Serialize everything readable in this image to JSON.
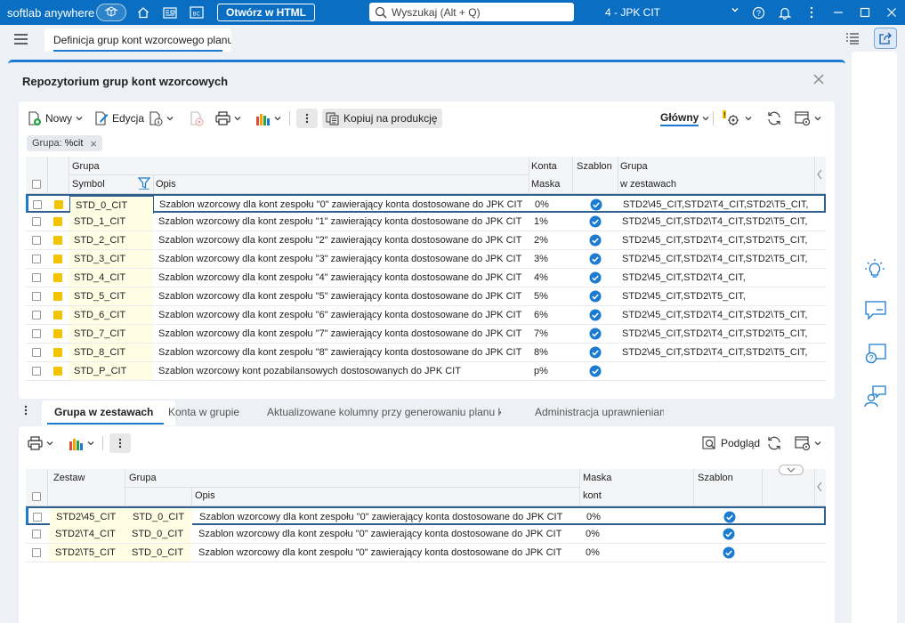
{
  "titlebar": {
    "brand": "softlab anywhere",
    "html_button": "Otwórz w HTML",
    "search_placeholder": "Wyszukaj (Alt + Q)",
    "company": "4 - JPK CIT"
  },
  "tab": {
    "label": "Definicja grup kont wzorcowego planu"
  },
  "panel": {
    "title": "Repozytorium grup kont wzorcowych"
  },
  "toolbar": {
    "new": "Nowy",
    "edit": "Edycja",
    "copy_to_production": "Kopiuj na produkcję",
    "view": "Główny"
  },
  "filter": {
    "label": "Grupa:",
    "value": "%cit"
  },
  "grid1": {
    "headers": {
      "group": "Grupa",
      "symbol": "Symbol",
      "desc": "Opis",
      "accounts": "Konta",
      "mask": "Maska",
      "template": "Szablon",
      "group2": "Grupa",
      "in_sets": "w zestawach"
    },
    "rows": [
      {
        "symbol": "STD_0_CIT",
        "desc": "Szablon wzorcowy dla kont zespołu \"0\" zawierający konta dostosowane do JPK CIT",
        "mask": "0%",
        "template": true,
        "sets": "STD2\\45_CIT,STD2\\T4_CIT,STD2\\T5_CIT,"
      },
      {
        "symbol": "STD_1_CIT",
        "desc": "Szablon wzorcowy dla kont zespołu \"1\" zawierający konta dostosowane do JPK CIT",
        "mask": "1%",
        "template": true,
        "sets": "STD2\\45_CIT,STD2\\T4_CIT,STD2\\T5_CIT,"
      },
      {
        "symbol": "STD_2_CIT",
        "desc": "Szablon wzorcowy dla kont zespołu \"2\" zawierający konta dostosowane do JPK CIT",
        "mask": "2%",
        "template": true,
        "sets": "STD2\\45_CIT,STD2\\T4_CIT,STD2\\T5_CIT,"
      },
      {
        "symbol": "STD_3_CIT",
        "desc": "Szablon wzorcowy dla kont zespołu \"3\" zawierający konta dostosowane do JPK CIT",
        "mask": "3%",
        "template": true,
        "sets": "STD2\\45_CIT,STD2\\T4_CIT,STD2\\T5_CIT,"
      },
      {
        "symbol": "STD_4_CIT",
        "desc": "Szablon wzorcowy dla kont zespołu \"4\" zawierający konta dostosowane do JPK CIT",
        "mask": "4%",
        "template": true,
        "sets": "STD2\\45_CIT,STD2\\T4_CIT,"
      },
      {
        "symbol": "STD_5_CIT",
        "desc": "Szablon wzorcowy dla kont zespołu \"5\" zawierający konta dostosowane do JPK CIT",
        "mask": "5%",
        "template": true,
        "sets": "STD2\\45_CIT,STD2\\T5_CIT,"
      },
      {
        "symbol": "STD_6_CIT",
        "desc": "Szablon wzorcowy dla kont zespołu \"6\" zawierający konta dostosowane do JPK CIT",
        "mask": "6%",
        "template": true,
        "sets": "STD2\\45_CIT,STD2\\T4_CIT,STD2\\T5_CIT,"
      },
      {
        "symbol": "STD_7_CIT",
        "desc": "Szablon wzorcowy dla kont zespołu \"7\" zawierający konta dostosowane do JPK CIT",
        "mask": "7%",
        "template": true,
        "sets": "STD2\\45_CIT,STD2\\T4_CIT,STD2\\T5_CIT,"
      },
      {
        "symbol": "STD_8_CIT",
        "desc": "Szablon wzorcowy dla kont zespołu \"8\" zawierający konta dostosowane do JPK CIT",
        "mask": "8%",
        "template": true,
        "sets": "STD2\\45_CIT,STD2\\T4_CIT,STD2\\T5_CIT,"
      },
      {
        "symbol": "STD_P_CIT",
        "desc": "Szablon wzorcowy kont pozabilansowych dostosowanych do JPK CIT",
        "mask": "p%",
        "template": true,
        "sets": ""
      }
    ]
  },
  "bottom_tabs": [
    "Grupa w zestawach",
    "Konta w grupie",
    "Aktualizowane kolumny przy generowaniu planu kont",
    "Administracja uprawnieniami"
  ],
  "toolbar2": {
    "preview": "Podgląd"
  },
  "grid2": {
    "headers": {
      "set": "Zestaw",
      "group": "Grupa",
      "desc": "Opis",
      "mask": "Maska",
      "accounts": "kont",
      "template": "Szablon"
    },
    "rows": [
      {
        "set": "STD2\\45_CIT",
        "group": "STD_0_CIT",
        "desc": "Szablon wzorcowy dla kont zespołu \"0\" zawierający konta dostosowane do JPK CIT",
        "mask": "0%",
        "template": true
      },
      {
        "set": "STD2\\T4_CIT",
        "group": "STD_0_CIT",
        "desc": "Szablon wzorcowy dla kont zespołu \"0\" zawierający konta dostosowane do JPK CIT",
        "mask": "0%",
        "template": true
      },
      {
        "set": "STD2\\T5_CIT",
        "group": "STD_0_CIT",
        "desc": "Szablon wzorcowy dla kont zespołu \"0\" zawierający konta dostosowane do JPK CIT",
        "mask": "0%",
        "template": true
      }
    ]
  },
  "colors": {
    "accent": "#1a7bd1",
    "titlebar": "#0a6fc2",
    "flag": "#f2c400",
    "symbol_bg": "#fffde4"
  }
}
